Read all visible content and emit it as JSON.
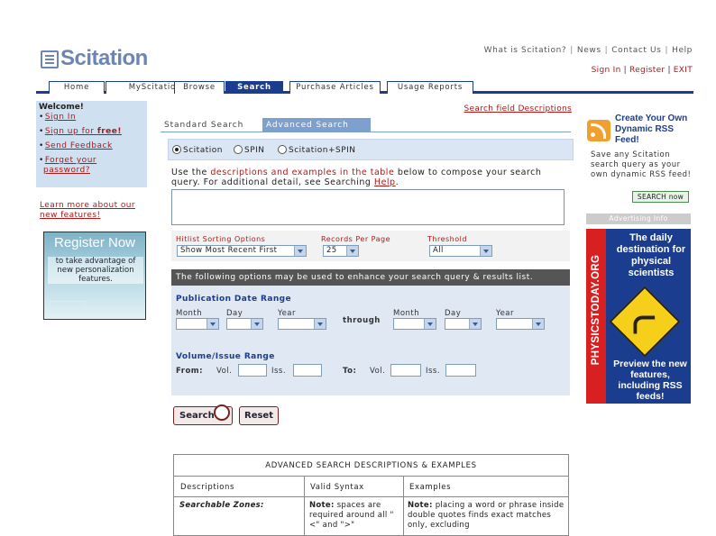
{
  "header": {
    "logo_text": "Scitation",
    "top_links": [
      "What is Scitation?",
      "News",
      "Contact Us",
      "Help"
    ],
    "sign_in": "Sign In",
    "register": "Register",
    "exit": "EXIT"
  },
  "nav": {
    "tabs": [
      {
        "label": "Home"
      },
      {
        "label": "MyScitation"
      },
      {
        "label": "Browse"
      },
      {
        "label": "Search"
      },
      {
        "label": "Purchase Articles"
      },
      {
        "label": "Usage Reports"
      }
    ]
  },
  "sidebar": {
    "welcome": "Welcome!",
    "sign_in": "Sign In",
    "sign_up_prefix": "Sign up for ",
    "sign_up_free": "free!",
    "send_feedback": "Send Feedback",
    "forgot_line1": "Forget your",
    "forgot_line2": "password?",
    "learn_line1": "Learn more about our",
    "learn_line2": "new features!",
    "register_title": "Register Now",
    "register_sub": "to take advantage of new personalization features."
  },
  "search": {
    "field_desc_link": "Search field Descriptions",
    "tab_standard": "Standard Search",
    "tab_advanced": "Advanced Search",
    "radio_scitation": "Scitation",
    "radio_spin": "SPIN",
    "radio_both": "Scitation+SPIN",
    "instr_prefix": "Use the ",
    "instr_link": "descriptions and examples in the table",
    "instr_mid": " below to compose your search query. For additional detail, see Searching ",
    "instr_help": "Help",
    "instr_end": ".",
    "hitlist_label": "Hitlist Sorting Options",
    "hitlist_value": "Show Most Recent First",
    "records_label": "Records Per Page",
    "records_value": "25",
    "threshold_label": "Threshold",
    "threshold_value": "All",
    "enhance_text": "The following options may be used to enhance your search query & results list.",
    "pub_date_head": "Publication Date Range",
    "month": "Month",
    "day": "Day",
    "year": "Year",
    "through": "through",
    "vol_head": "Volume/Issue Range",
    "from": "From:",
    "to": "To:",
    "vol": "Vol.",
    "iss": "Iss.",
    "btn_search": "Search",
    "btn_reset": "Reset"
  },
  "table": {
    "title": "ADVANCED SEARCH DESCRIPTIONS & EXAMPLES",
    "col_desc": "Descriptions",
    "col_syntax": "Valid Syntax",
    "col_examples": "Examples",
    "row1_desc": "Searchable Zones:",
    "row1_syntax_bold": "Note:",
    "row1_syntax": " spaces are required around all \"<\" and \">\"",
    "row1_example_bold": "Note:",
    "row1_example": " placing a word or phrase inside double quotes finds exact matches only, excluding"
  },
  "right": {
    "rss_head": "Create Your Own Dynamic RSS Feed!",
    "rss_text": "Save any Scitation search query as your own dynamic RSS feed!",
    "rss_button": "SEARCH now",
    "ad_info": "Advertising Info",
    "pt_vertical": "PHYSICSTODAY.ORG",
    "pt_head": "The daily destination for physical scientists",
    "pt_foot": "Preview the new features, including RSS feeds!"
  }
}
